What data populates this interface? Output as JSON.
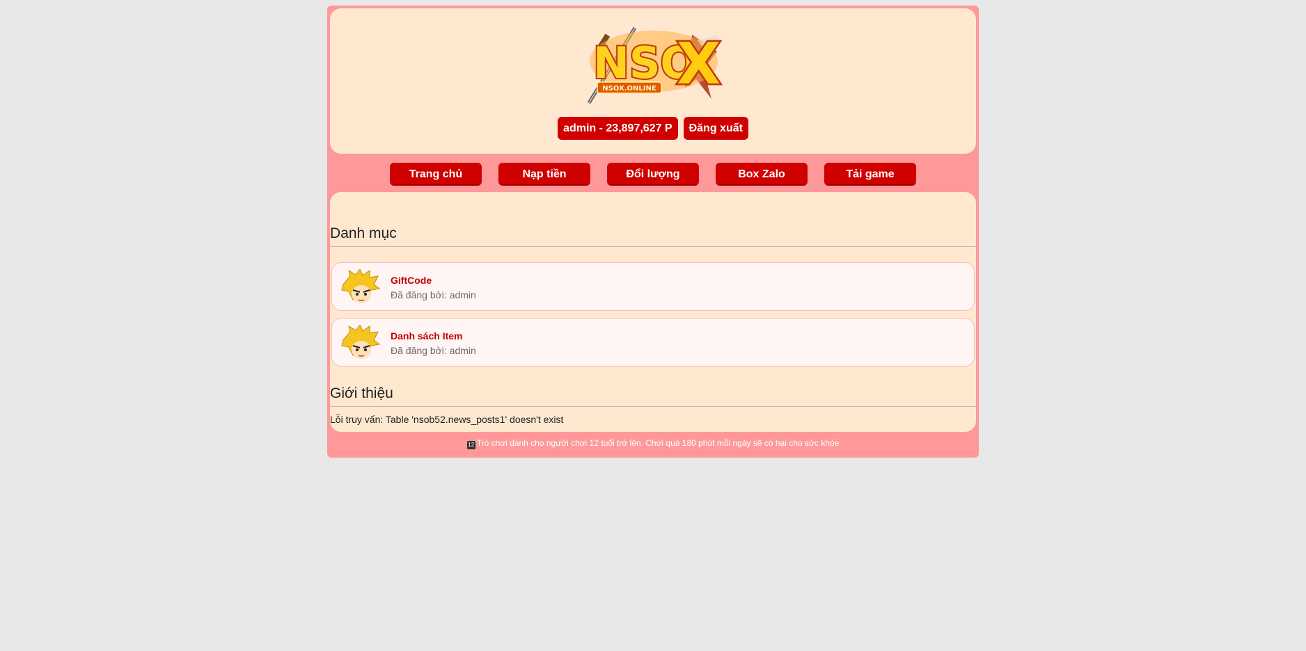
{
  "header": {
    "logo_text": "NSOX",
    "logo_subtext": "NSOX.ONLINE",
    "user_balance": "admin - 23,897,627 P",
    "logout_label": "Đăng xuất"
  },
  "nav": {
    "items": [
      {
        "label": "Trang chủ"
      },
      {
        "label": "Nạp tiền"
      },
      {
        "label": "Đổi lượng"
      },
      {
        "label": "Box Zalo"
      },
      {
        "label": "Tải game"
      }
    ]
  },
  "categories": {
    "title": "Danh mục",
    "items": [
      {
        "title": "GiftCode",
        "meta": "Đã đăng bởi: admin"
      },
      {
        "title": "Danh sách Item",
        "meta": "Đã đăng bởi: admin"
      }
    ]
  },
  "intro": {
    "title": "Giới thiệu",
    "error_text": "Lỗi truy vấn: Table 'nsob52.news_posts1' doesn't exist"
  },
  "footer": {
    "age_badge": "12",
    "text": "Trò chơi dành cho người chơi 12 tuổi trở lên. Chơi quá 180 phút mỗi ngày sẽ có hại cho sức khỏe"
  },
  "colors": {
    "page_bg": "#e8e8e8",
    "frame_bg": "#ff9999",
    "panel_bg": "#ffe8d0",
    "button_red": "#d00000",
    "link_red": "#c00000"
  }
}
